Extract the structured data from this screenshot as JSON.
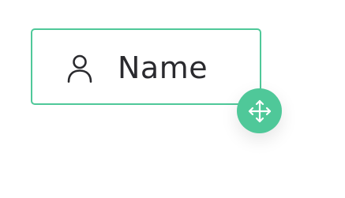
{
  "field": {
    "label": "Name",
    "icon": "user-icon"
  },
  "handle": {
    "icon": "move-arrows-icon"
  },
  "colors": {
    "accent": "#4fc899",
    "text": "#2a2a2e"
  }
}
